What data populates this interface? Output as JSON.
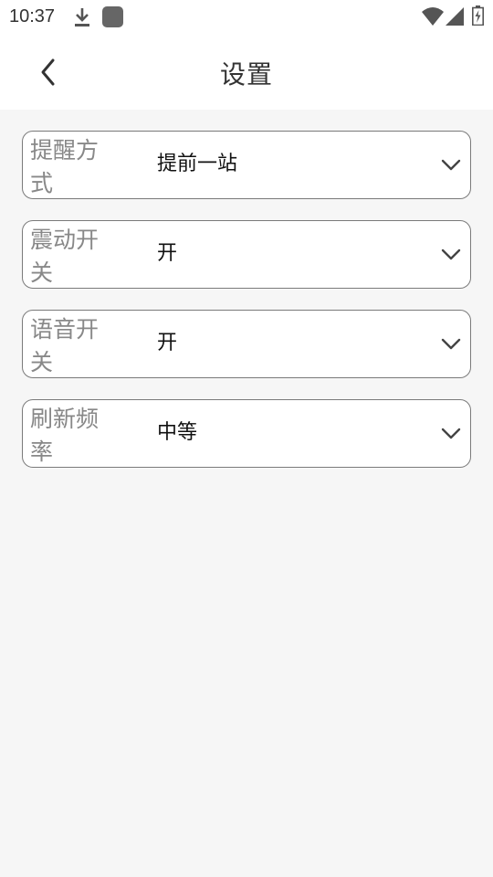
{
  "status_bar": {
    "time": "10:37",
    "icons": [
      "download-icon",
      "app-badge-icon",
      "wifi-icon",
      "signal-icon",
      "battery-charging-icon"
    ]
  },
  "header": {
    "title": "设置",
    "back_icon": "chevron-left-icon"
  },
  "settings": [
    {
      "label": "提醒方式",
      "value": "提前一站",
      "icon": "chevron-down-icon"
    },
    {
      "label": "震动开关",
      "value": "开",
      "icon": "chevron-down-icon"
    },
    {
      "label": "语音开关",
      "value": "开",
      "icon": "chevron-down-icon"
    },
    {
      "label": "刷新频率",
      "value": "中等",
      "icon": "chevron-down-icon"
    }
  ],
  "colors": {
    "background": "#f6f6f6",
    "surface": "#ffffff",
    "border": "#7a7a7a",
    "label": "#888888",
    "value": "#111111"
  }
}
